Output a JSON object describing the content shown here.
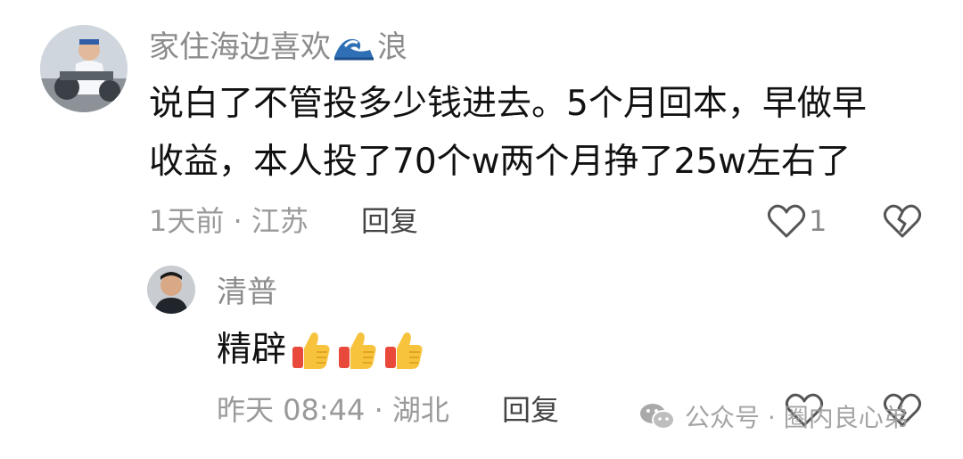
{
  "comment": {
    "username": "家住海边喜欢",
    "username_emoji": "wave-icon",
    "username_suffix": "浪",
    "text_line1": "说白了不管投多少钱进去。5个月回本，早做早",
    "text_line2": "收益，本人投了70个w两个月挣了25w左右了",
    "meta": "1天前 · 江苏",
    "reply_label": "回复",
    "like_count": "1"
  },
  "reply": {
    "username": "清普",
    "text": "精辟",
    "emojis": [
      "thumbs-up-icon",
      "thumbs-up-icon",
      "thumbs-up-icon"
    ],
    "meta": "昨天 08:44 · 湖北",
    "reply_label": "回复"
  },
  "watermark": {
    "text": "公众号 · 圈内良心弟",
    "icon": "wechat-icon"
  }
}
